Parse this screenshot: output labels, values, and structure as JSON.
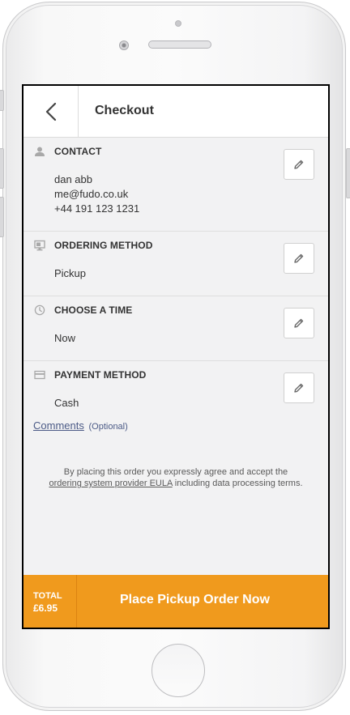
{
  "header": {
    "title": "Checkout"
  },
  "sections": {
    "contact": {
      "title": "CONTACT",
      "name": "dan abb",
      "email": "me@fudo.co.uk",
      "phone": "+44 191 123 1231"
    },
    "ordering_method": {
      "title": "ORDERING METHOD",
      "value": "Pickup"
    },
    "choose_time": {
      "title": "CHOOSE A TIME",
      "value": "Now"
    },
    "payment_method": {
      "title": "PAYMENT METHOD",
      "value": "Cash"
    }
  },
  "comments": {
    "link": "Comments",
    "optional": "(Optional)"
  },
  "legal": {
    "prefix": "By placing this order you expressly agree and accept the",
    "link": "ordering system provider EULA",
    "suffix": " including data processing terms."
  },
  "footer": {
    "total_label": "TOTAL",
    "total_value": "£6.95",
    "button": "Place Pickup Order Now"
  },
  "colors": {
    "accent": "#f09a1d",
    "link": "#4b5a86",
    "background": "#f2f2f3"
  },
  "icons": [
    "back-chevron-icon",
    "user-icon",
    "monitor-icon",
    "clock-icon",
    "card-icon",
    "pencil-icon"
  ]
}
